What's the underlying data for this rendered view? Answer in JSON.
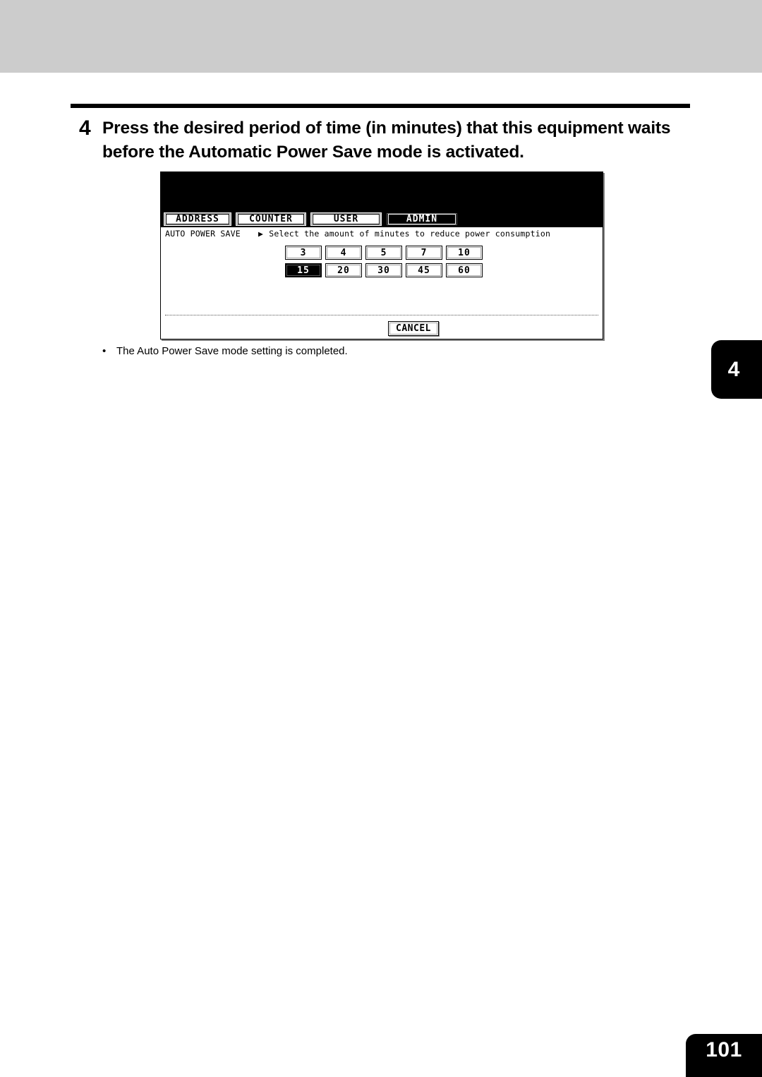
{
  "page": {
    "number": "101",
    "chapter_tab": "4",
    "header_band_color": "#cccccc"
  },
  "step": {
    "number": "4",
    "text": "Press the desired period of time (in minutes) that this equipment waits before the Automatic Power Save mode is activated."
  },
  "lcd": {
    "tabs": [
      {
        "label": "ADDRESS",
        "active": false
      },
      {
        "label": "COUNTER",
        "active": false
      },
      {
        "label": "USER",
        "active": false
      },
      {
        "label": "ADMIN",
        "active": true
      }
    ],
    "status": {
      "label": "AUTO POWER SAVE",
      "arrow": "▶",
      "message": "Select the amount of minutes to reduce power consumption"
    },
    "minute_buttons": {
      "row1": [
        {
          "value": "3",
          "selected": false
        },
        {
          "value": "4",
          "selected": false
        },
        {
          "value": "5",
          "selected": false
        },
        {
          "value": "7",
          "selected": false
        },
        {
          "value": "10",
          "selected": false
        }
      ],
      "row2": [
        {
          "value": "15",
          "selected": true
        },
        {
          "value": "20",
          "selected": false
        },
        {
          "value": "30",
          "selected": false
        },
        {
          "value": "45",
          "selected": false
        },
        {
          "value": "60",
          "selected": false
        }
      ]
    },
    "cancel_label": "CANCEL"
  },
  "note": {
    "bullet": "•",
    "text": "The Auto Power Save mode setting is completed."
  }
}
